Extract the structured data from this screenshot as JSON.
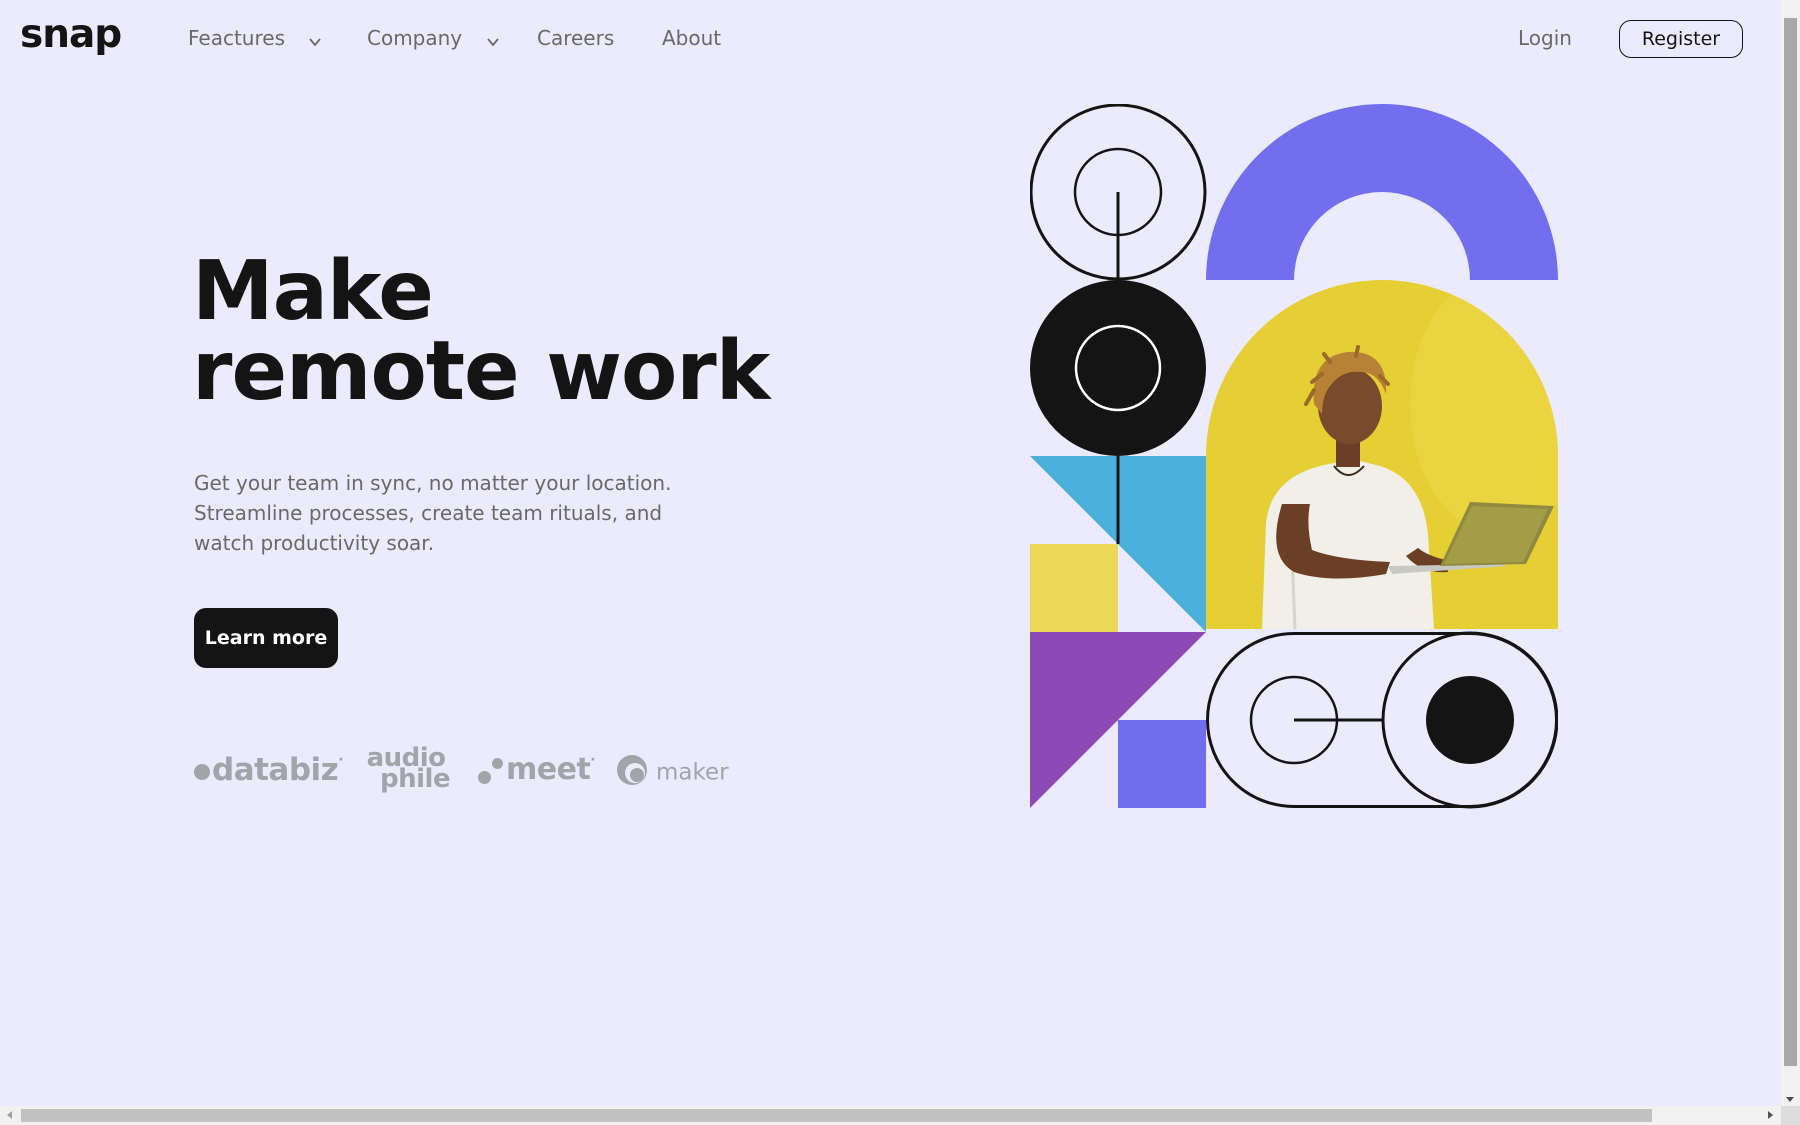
{
  "header": {
    "logo": "snap",
    "nav": [
      {
        "label": "Feactures",
        "has_dropdown": true
      },
      {
        "label": "Company",
        "has_dropdown": true
      },
      {
        "label": "Careers",
        "has_dropdown": false
      },
      {
        "label": "About",
        "has_dropdown": false
      }
    ],
    "login_label": "Login",
    "register_label": "Register"
  },
  "hero": {
    "headline_line1": "Make",
    "headline_line2": "remote work",
    "subtitle_lines": [
      "Get your team in sync, no matter your location.",
      "Streamline processes, create team rituals, and",
      "watch productivity soar."
    ],
    "cta_label": "Learn more"
  },
  "clients": [
    {
      "name": "databiz",
      "icon": "databiz-logo"
    },
    {
      "name": "audiophile",
      "line1": "audio",
      "line2": "phile",
      "icon": "audiophile-logo"
    },
    {
      "name": "meet",
      "icon": "meet-logo"
    },
    {
      "name": "maker",
      "icon": "maker-logo"
    }
  ],
  "illustration": {
    "icon": "geometric-hero-illustration",
    "photo_subject": "person-holding-laptop-photo",
    "colors": {
      "purple_arch": "#726eed",
      "photo_bg": "#e5cf35",
      "blue_triangle": "#4bb0dc",
      "yellow_square": "#ecd756",
      "violet_triangle": "#8b4ab6",
      "periwinkle_square": "#716eed",
      "ink": "#141414"
    }
  },
  "theme": {
    "background": "#ebebfd",
    "text_primary": "#141414",
    "text_muted": "#696969",
    "logo_gray": "#a3a3aa"
  }
}
